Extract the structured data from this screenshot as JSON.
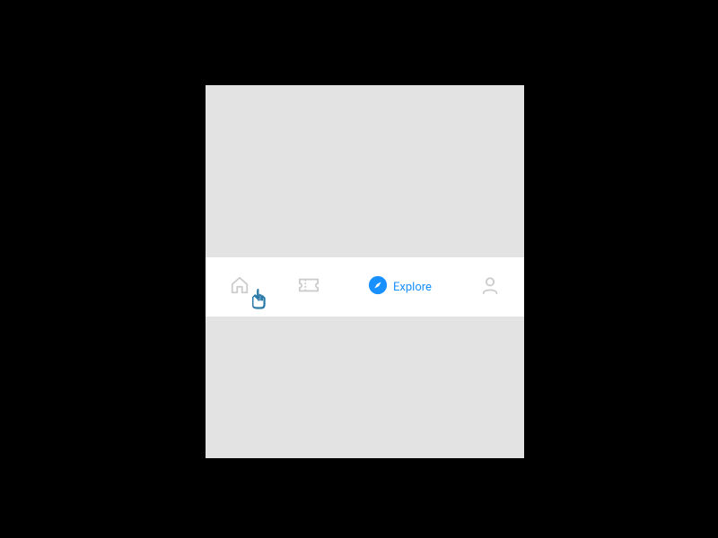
{
  "tabs": {
    "home": {
      "label": "Home",
      "active": false
    },
    "tickets": {
      "label": "Tickets",
      "active": false
    },
    "explore": {
      "label": "Explore",
      "active": true
    },
    "profile": {
      "label": "Profile",
      "active": false
    }
  },
  "colors": {
    "accent": "#1890ff",
    "inactive": "#cccccc",
    "frame_bg": "#e3e3e3",
    "bar_bg": "#ffffff"
  }
}
